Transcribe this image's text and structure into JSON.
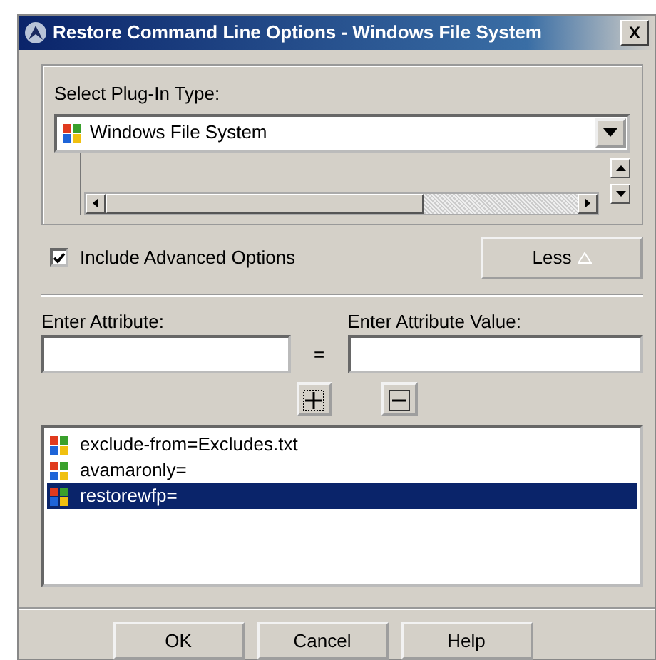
{
  "window": {
    "title": "Restore Command Line Options - Windows File System",
    "close": "X"
  },
  "plugin": {
    "label": "Select Plug-In Type:",
    "value": "Windows File System"
  },
  "advanced": {
    "label": "Include Advanced Options",
    "checked": true
  },
  "less_button": {
    "label": "Less"
  },
  "attribute": {
    "label": "Enter Attribute:"
  },
  "equals": "=",
  "attribute_value": {
    "label": "Enter Attribute Value:"
  },
  "attributes": [
    {
      "text": "exclude-from=Excludes.txt",
      "selected": false
    },
    {
      "text": "avamaronly=",
      "selected": false
    },
    {
      "text": "restorewfp=",
      "selected": true
    }
  ],
  "buttons": [
    "OK",
    "Cancel",
    "Help"
  ]
}
